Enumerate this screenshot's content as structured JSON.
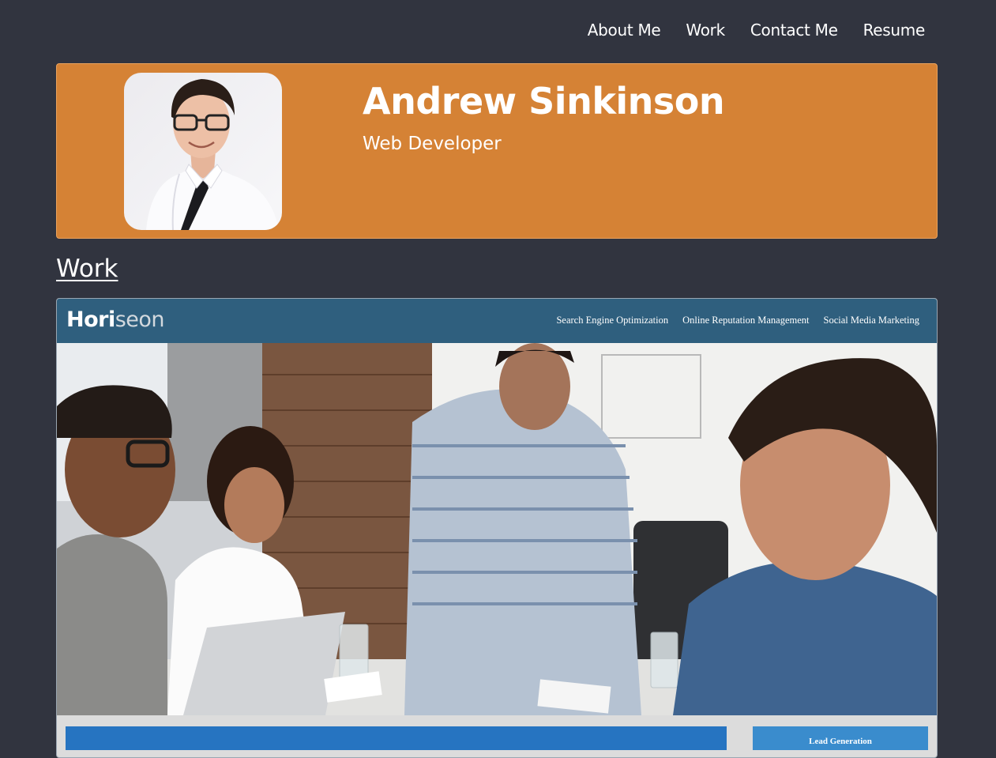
{
  "nav": {
    "items": [
      {
        "label": "About Me"
      },
      {
        "label": "Work"
      },
      {
        "label": "Contact Me"
      },
      {
        "label": "Resume"
      }
    ]
  },
  "hero": {
    "name": "Andrew Sinkinson",
    "role": "Web Developer",
    "background_color": "#d58235"
  },
  "work": {
    "heading": "Work",
    "project": {
      "logo_prefix": "Hori",
      "logo_accent": "seon",
      "nav": [
        {
          "label": "Search Engine Optimization"
        },
        {
          "label": "Online Reputation Management"
        },
        {
          "label": "Social Media Marketing"
        }
      ],
      "side_button": "Lead Generation",
      "header_color": "#2f5f7e"
    }
  },
  "colors": {
    "page_background": "#31343f",
    "accent": "#d58235",
    "project_bar": "#2674c1"
  }
}
